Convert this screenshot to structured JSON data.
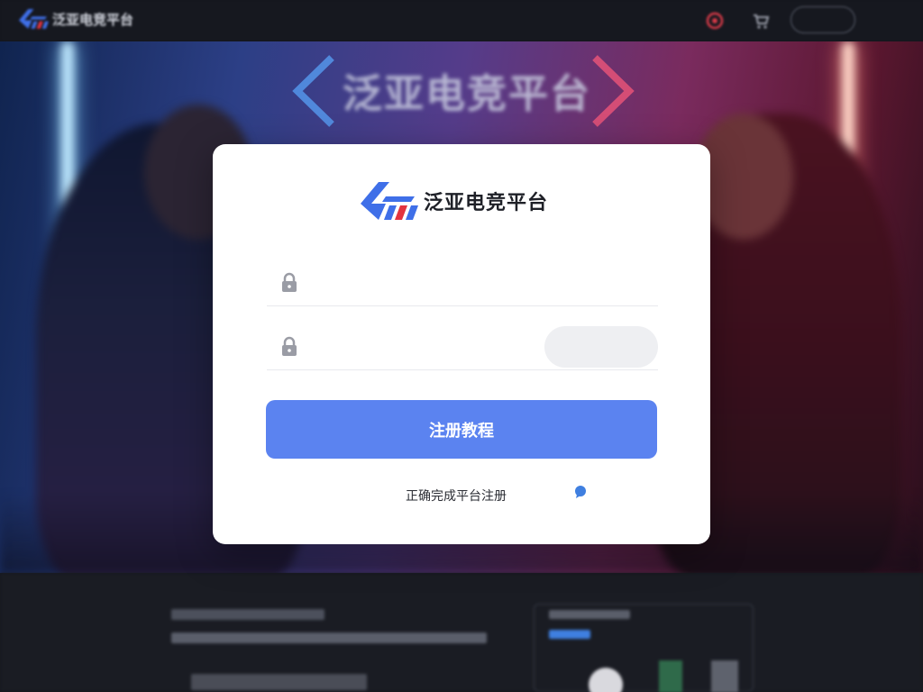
{
  "nav": {
    "brand": "泛亚电竞平台",
    "links": [
      "",
      ""
    ],
    "pill": "",
    "lang": ""
  },
  "hero": {
    "title": "泛亚电竞平台"
  },
  "modal": {
    "brand": "泛亚电竞平台",
    "account_placeholder": "",
    "code_placeholder": "",
    "code_button": "",
    "submit_label": "注册教程",
    "hint": "正确完成平台注册",
    "link_label": ""
  },
  "colors": {
    "accent": "#5b83f0",
    "link": "#3f7fe0",
    "brand_red": "#e3343f"
  }
}
